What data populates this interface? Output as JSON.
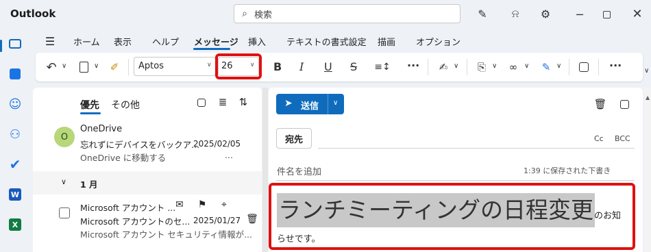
{
  "app": {
    "title": "Outlook"
  },
  "search": {
    "label": "検索"
  },
  "menu": {
    "items": [
      "ホーム",
      "表示",
      "ヘルプ",
      "メッセージ",
      "挿入",
      "テキストの書式設定",
      "描画",
      "オプション"
    ],
    "active": "メッセージ"
  },
  "ribbon": {
    "font_name": "Aptos",
    "font_size": "26",
    "bold": "B",
    "italic": "I",
    "underline": "U",
    "strike": "S",
    "more": "···"
  },
  "list": {
    "tabs": [
      "優先",
      "その他"
    ],
    "active_tab": "優先",
    "items": [
      {
        "avatar_letter": "O",
        "sender": "OneDrive",
        "subject": "忘れずにデバイスをバックア...",
        "date": "2025/02/05",
        "preview": "OneDrive に移動する",
        "preview_more": "..."
      },
      {
        "sender": "Microsoft アカウント ...",
        "subject": "Microsoft アカウントのセ...",
        "date": "2025/01/27",
        "preview": "Microsoft アカウント セキュリティ情報が..."
      }
    ],
    "group_label": "1 月"
  },
  "compose": {
    "send_label": "送信",
    "to_label": "宛先",
    "cc": "Cc",
    "bcc": "BCC",
    "subject_placeholder": "件名を追加",
    "saved_status": "1:39 に保存された下書き",
    "body_highlight": "ランチミーティングの日程変更",
    "body_tail": "のお知",
    "body_line2": "らせです。"
  },
  "colors": {
    "accent": "#0f6cbd",
    "highlight_box": "#e01010",
    "selection": "#c8c8c8"
  }
}
